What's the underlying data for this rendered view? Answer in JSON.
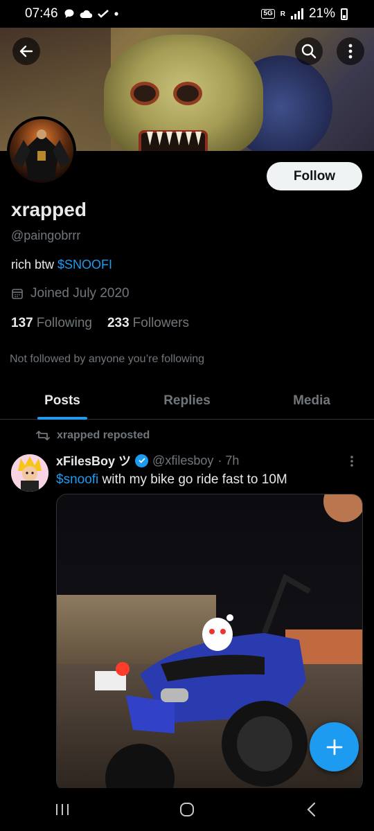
{
  "status_bar": {
    "time": "07:46",
    "network": "5G",
    "roaming": "R",
    "battery": "21%"
  },
  "profile": {
    "name": "xrapped",
    "handle": "@paingobrrr",
    "bio_text": "rich btw ",
    "bio_cashtag": "$SNOOFI",
    "joined": "Joined July 2020",
    "following_count": "137",
    "following_label": "Following",
    "followers_count": "233",
    "followers_label": "Followers",
    "not_followed": "Not followed by anyone you’re following",
    "follow_label": "Follow"
  },
  "tabs": [
    {
      "label": "Posts",
      "active": true
    },
    {
      "label": "Replies",
      "active": false
    },
    {
      "label": "Media",
      "active": false
    }
  ],
  "post": {
    "repost_label": "xrapped reposted",
    "author_name": "xFilesBoy ツ",
    "author_handle": "@xfilesboy",
    "time": "· 7h",
    "cashtag": "$snoofi",
    "text": " with my bike go ride fast to 10M"
  },
  "colors": {
    "accent": "#1d9bf0",
    "background": "#000000",
    "text": "#e7e9ea",
    "muted": "#71767b"
  },
  "icons": {
    "back": "back-arrow-icon",
    "search": "search-icon",
    "more": "more-vertical-icon",
    "calendar": "calendar-icon",
    "repost": "repost-icon",
    "verified": "verified-badge-icon",
    "compose": "plus-icon"
  }
}
